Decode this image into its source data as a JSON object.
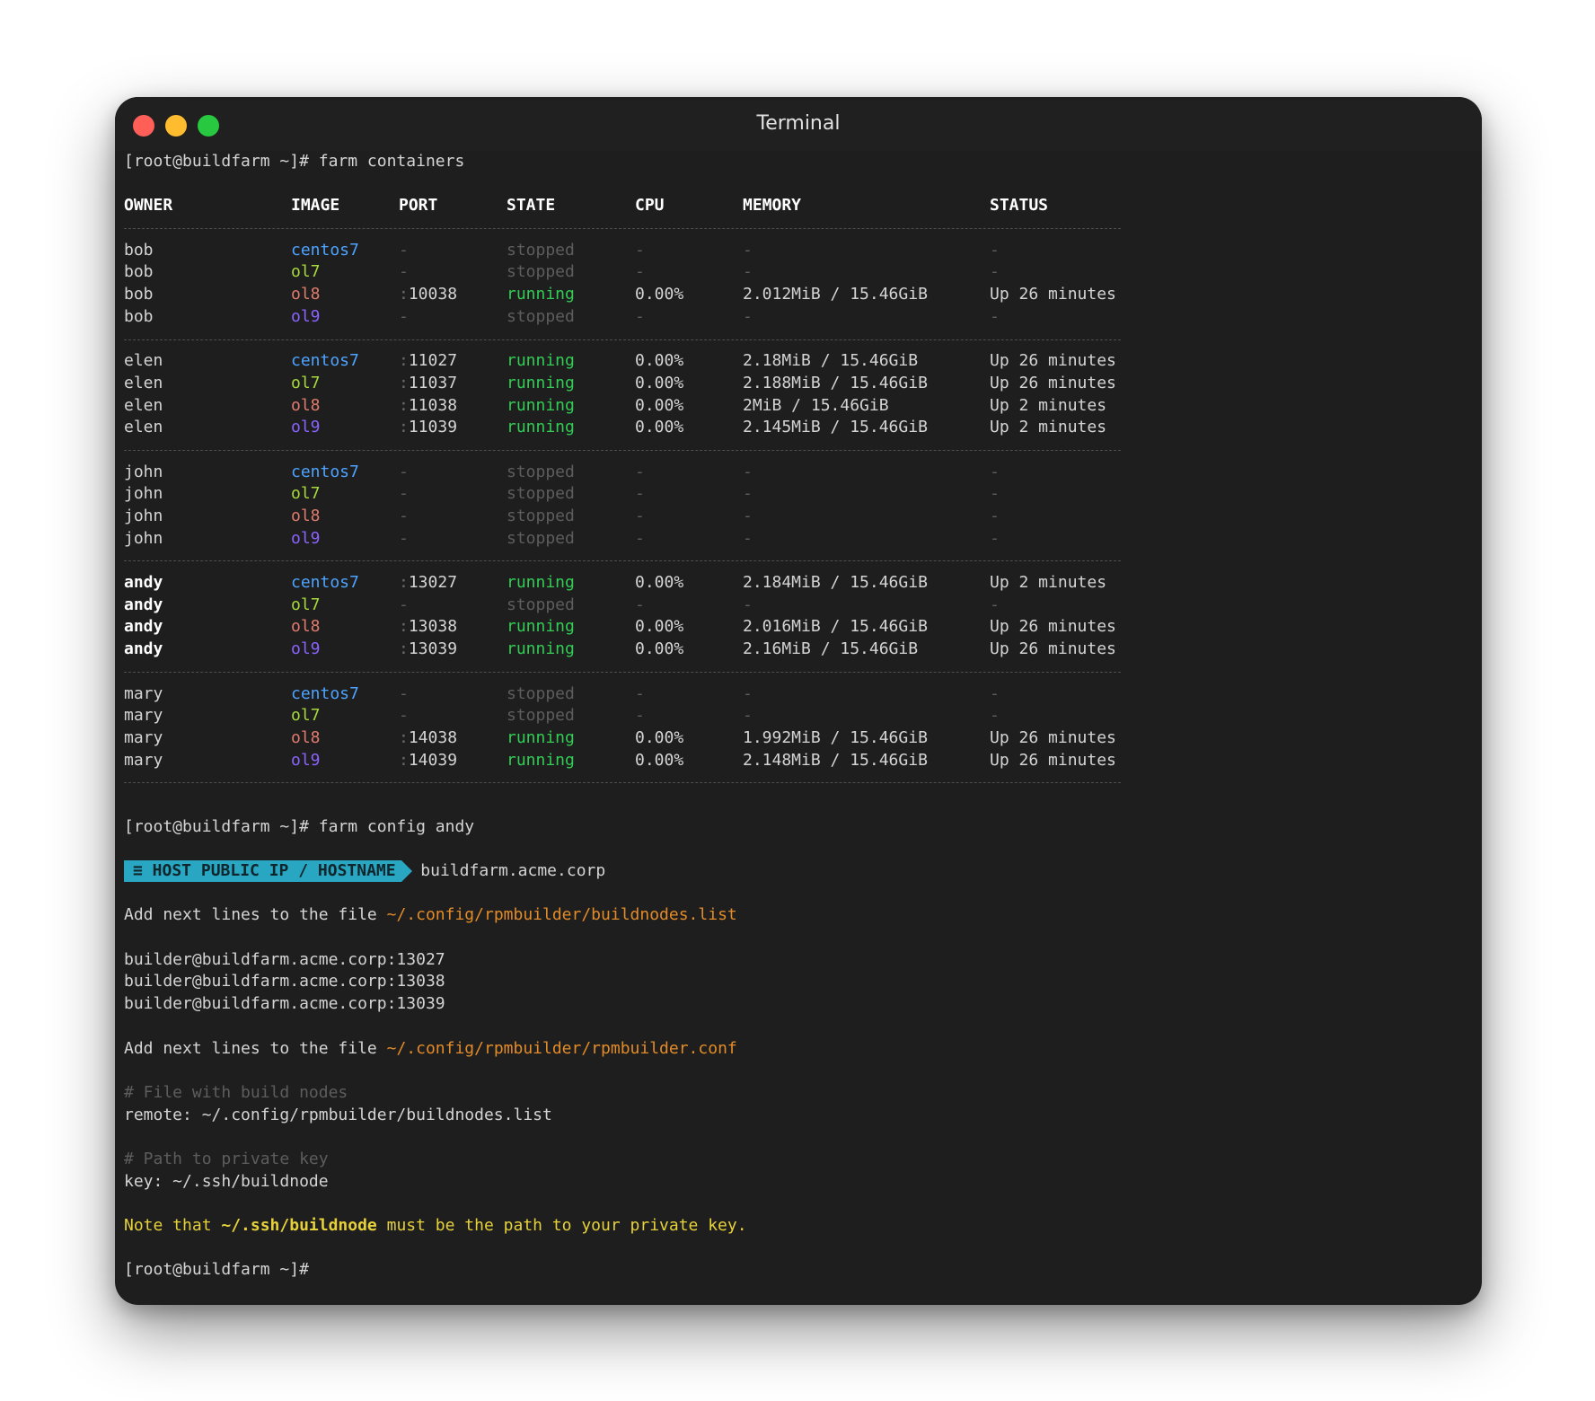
{
  "window": {
    "title": "Terminal",
    "background": "#1e1e1e",
    "traffic_lights": {
      "close": "#ff5f57",
      "minimize": "#febc2e",
      "zoom": "#28c840"
    }
  },
  "colors": {
    "centos7": "#4da3ff",
    "ol7": "#a6d93b",
    "ol8": "#e07b6c",
    "ol9": "#8a63ff",
    "running": "#33cc55",
    "stopped": "#5d5d5d",
    "path": "#e28b28",
    "note": "#e6d13a",
    "comment": "#5d5d5d"
  },
  "commands": {
    "cmd1": "[root@buildfarm ~]# farm containers",
    "cmd2": "[root@buildfarm ~]# farm config andy",
    "cmd3": "[root@buildfarm ~]#"
  },
  "table": {
    "headers": {
      "owner": "OWNER",
      "image": "IMAGE",
      "port": "PORT",
      "state": "STATE",
      "cpu": "CPU",
      "memory": "MEMORY",
      "status": "STATUS"
    },
    "groups": [
      {
        "rows": [
          {
            "owner": "bob",
            "image": "centos7",
            "port": "-",
            "state": "stopped",
            "cpu": "-",
            "memory": "-",
            "status": "-"
          },
          {
            "owner": "bob",
            "image": "ol7",
            "port": "-",
            "state": "stopped",
            "cpu": "-",
            "memory": "-",
            "status": "-"
          },
          {
            "owner": "bob",
            "image": "ol8",
            "port": "10038",
            "state": "running",
            "cpu": "0.00%",
            "memory": "2.012MiB / 15.46GiB",
            "status": "Up 26 minutes"
          },
          {
            "owner": "bob",
            "image": "ol9",
            "port": "-",
            "state": "stopped",
            "cpu": "-",
            "memory": "-",
            "status": "-"
          }
        ]
      },
      {
        "rows": [
          {
            "owner": "elen",
            "image": "centos7",
            "port": "11027",
            "state": "running",
            "cpu": "0.00%",
            "memory": "2.18MiB / 15.46GiB",
            "status": "Up 26 minutes"
          },
          {
            "owner": "elen",
            "image": "ol7",
            "port": "11037",
            "state": "running",
            "cpu": "0.00%",
            "memory": "2.188MiB / 15.46GiB",
            "status": "Up 26 minutes"
          },
          {
            "owner": "elen",
            "image": "ol8",
            "port": "11038",
            "state": "running",
            "cpu": "0.00%",
            "memory": "2MiB / 15.46GiB",
            "status": "Up 2 minutes"
          },
          {
            "owner": "elen",
            "image": "ol9",
            "port": "11039",
            "state": "running",
            "cpu": "0.00%",
            "memory": "2.145MiB / 15.46GiB",
            "status": "Up 2 minutes"
          }
        ]
      },
      {
        "rows": [
          {
            "owner": "john",
            "image": "centos7",
            "port": "-",
            "state": "stopped",
            "cpu": "-",
            "memory": "-",
            "status": "-"
          },
          {
            "owner": "john",
            "image": "ol7",
            "port": "-",
            "state": "stopped",
            "cpu": "-",
            "memory": "-",
            "status": "-"
          },
          {
            "owner": "john",
            "image": "ol8",
            "port": "-",
            "state": "stopped",
            "cpu": "-",
            "memory": "-",
            "status": "-"
          },
          {
            "owner": "john",
            "image": "ol9",
            "port": "-",
            "state": "stopped",
            "cpu": "-",
            "memory": "-",
            "status": "-"
          }
        ]
      },
      {
        "highlight": true,
        "rows": [
          {
            "owner": "andy",
            "image": "centos7",
            "port": "13027",
            "state": "running",
            "cpu": "0.00%",
            "memory": "2.184MiB / 15.46GiB",
            "status": "Up 2 minutes"
          },
          {
            "owner": "andy",
            "image": "ol7",
            "port": "-",
            "state": "stopped",
            "cpu": "-",
            "memory": "-",
            "status": "-"
          },
          {
            "owner": "andy",
            "image": "ol8",
            "port": "13038",
            "state": "running",
            "cpu": "0.00%",
            "memory": "2.016MiB / 15.46GiB",
            "status": "Up 26 minutes"
          },
          {
            "owner": "andy",
            "image": "ol9",
            "port": "13039",
            "state": "running",
            "cpu": "0.00%",
            "memory": "2.16MiB / 15.46GiB",
            "status": "Up 26 minutes"
          }
        ]
      },
      {
        "rows": [
          {
            "owner": "mary",
            "image": "centos7",
            "port": "-",
            "state": "stopped",
            "cpu": "-",
            "memory": "-",
            "status": "-"
          },
          {
            "owner": "mary",
            "image": "ol7",
            "port": "-",
            "state": "stopped",
            "cpu": "-",
            "memory": "-",
            "status": "-"
          },
          {
            "owner": "mary",
            "image": "ol8",
            "port": "14038",
            "state": "running",
            "cpu": "0.00%",
            "memory": "1.992MiB / 15.46GiB",
            "status": "Up 26 minutes"
          },
          {
            "owner": "mary",
            "image": "ol9",
            "port": "14039",
            "state": "running",
            "cpu": "0.00%",
            "memory": "2.148MiB / 15.46GiB",
            "status": "Up 26 minutes"
          }
        ]
      }
    ]
  },
  "config": {
    "badge_label": "≡ HOST PUBLIC IP / HOSTNAME",
    "hostname": "buildfarm.acme.corp",
    "add_lines_prefix": "Add next lines to the file ",
    "nodes_file": "~/.config/rpmbuilder/buildnodes.list",
    "nodes": [
      "builder@buildfarm.acme.corp:13027",
      "builder@buildfarm.acme.corp:13038",
      "builder@buildfarm.acme.corp:13039"
    ],
    "conf_file": "~/.config/rpmbuilder/rpmbuilder.conf",
    "comment_nodes": "# File with build nodes",
    "remote_line": "remote: ~/.config/rpmbuilder/buildnodes.list",
    "comment_key": "# Path to private key",
    "key_line": "key: ~/.ssh/buildnode",
    "note_prefix": "Note that ",
    "note_path": "~/.ssh/buildnode",
    "note_suffix": " must be the path to your private key."
  }
}
